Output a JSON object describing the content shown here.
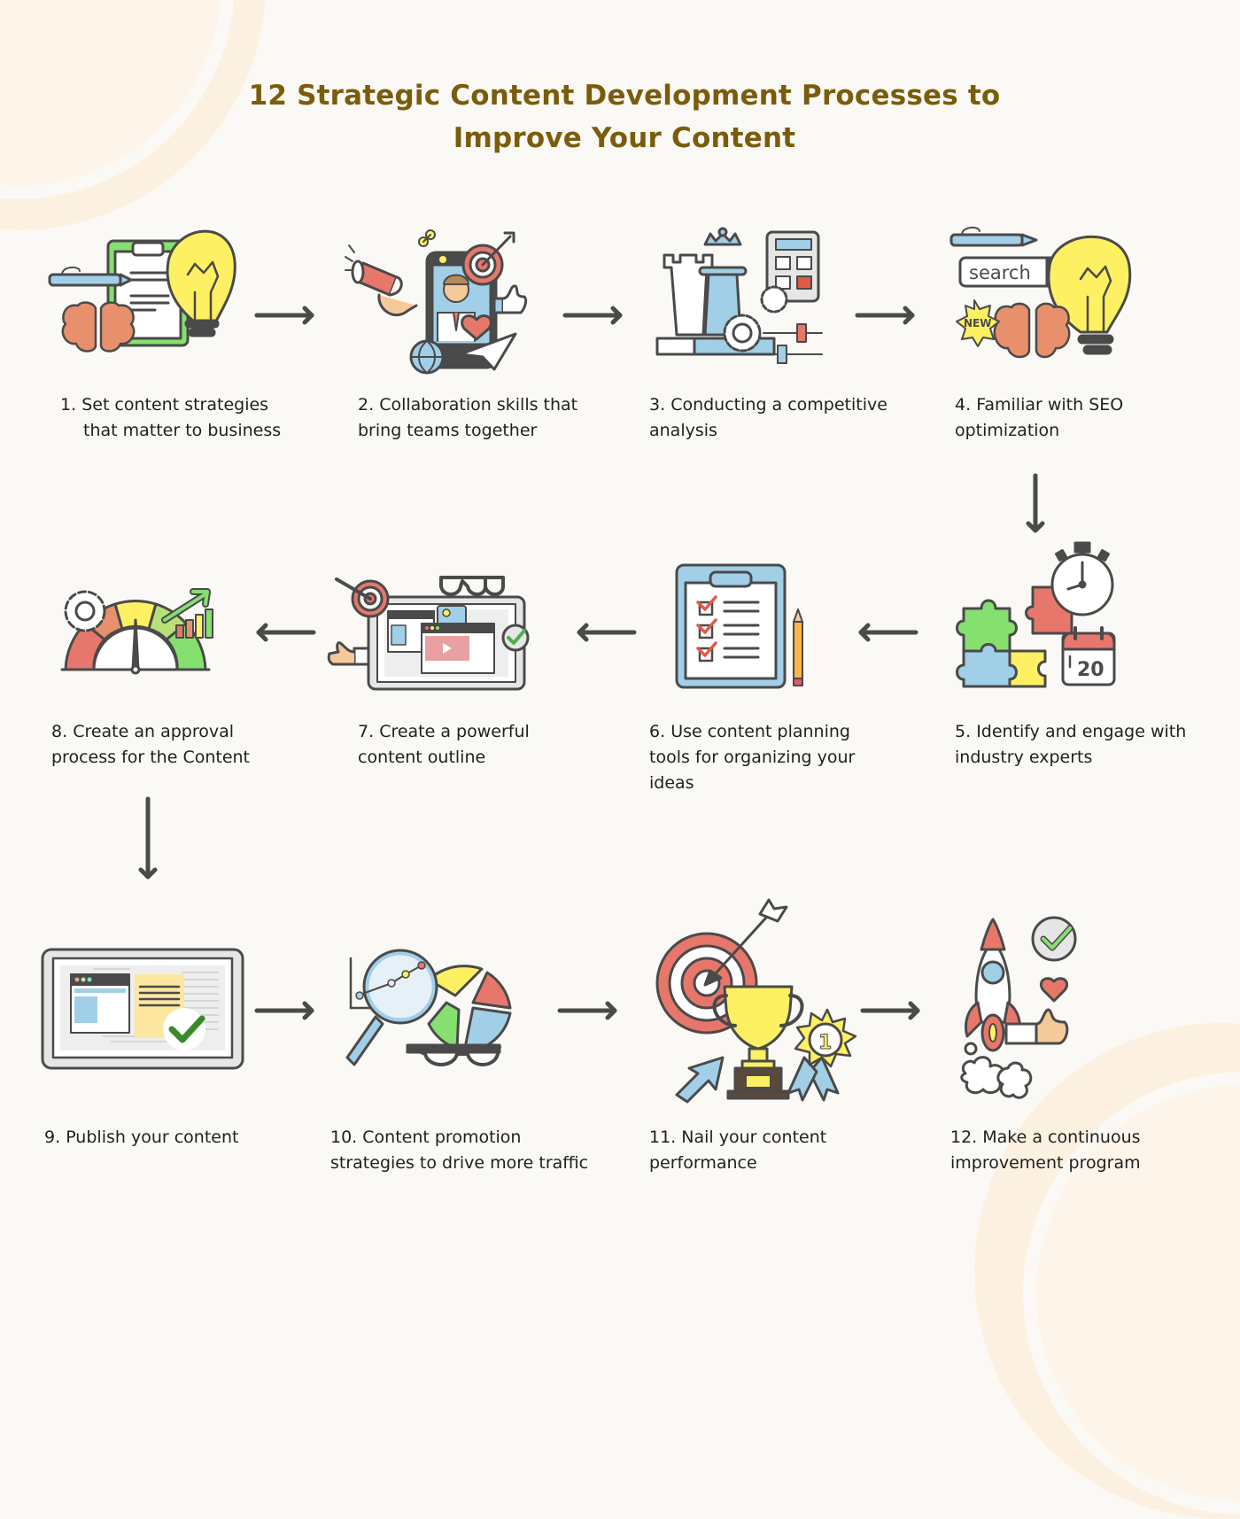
{
  "title_line1": "12 Strategic Content Development Processes to",
  "title_line2": "Improve Your Content",
  "steps": [
    {
      "number": "1.",
      "text_line1": "Set content strategies",
      "text_line2": "that matter to business",
      "icon": "clipboard-lightbulb-brain-icon"
    },
    {
      "number": "2.",
      "text_line1": "Collaboration skills that",
      "text_line2": "bring teams together",
      "icon": "phone-megaphone-target-icon"
    },
    {
      "number": "3.",
      "text_line1": "Conducting a competitive",
      "text_line2": "analysis",
      "icon": "chess-calculator-gears-icon"
    },
    {
      "number": "4.",
      "text_line1": "Familiar with SEO",
      "text_line2": "optimization",
      "icon": "search-lightbulb-brain-icon",
      "search_text": "search",
      "badge_text": "NEW"
    },
    {
      "number": "5.",
      "text_line1": "Identify and engage with",
      "text_line2": "industry experts",
      "icon": "puzzle-stopwatch-calendar-icon",
      "calendar_day": "20"
    },
    {
      "number": "6.",
      "text_line1": "Use content planning",
      "text_line2": "tools for organizing your",
      "text_line3": "ideas",
      "icon": "checklist-clipboard-icon"
    },
    {
      "number": "7.",
      "text_line1": "Create a powerful",
      "text_line2": "content outline",
      "icon": "laptop-video-outline-icon"
    },
    {
      "number": "8.",
      "text_line1": "Create an approval",
      "text_line2": "process for the Content",
      "icon": "speedometer-gauge-icon"
    },
    {
      "number": "9.",
      "text_line1": "Publish your content",
      "icon": "tablet-publish-check-icon"
    },
    {
      "number": "10.",
      "text_line1": "Content promotion",
      "text_line2": "strategies to drive more traffic",
      "icon": "magnifier-piechart-icon"
    },
    {
      "number": "11.",
      "text_line1": "Nail your content",
      "text_line2": "performance",
      "icon": "trophy-target-medal-icon",
      "medal_text": "1"
    },
    {
      "number": "12.",
      "text_line1": "Make a continuous",
      "text_line2": "improvement program",
      "icon": "rocket-thumbsup-icon"
    }
  ],
  "colors": {
    "title": "#7a5c0c",
    "background": "#fbf9f5",
    "decor": "#fcf0e0",
    "outline": "#4a4a4a",
    "red": "#e8776b",
    "yellow": "#fdf062",
    "green": "#86e06f",
    "blue": "#a2cfe8",
    "brain": "#e8906b"
  }
}
